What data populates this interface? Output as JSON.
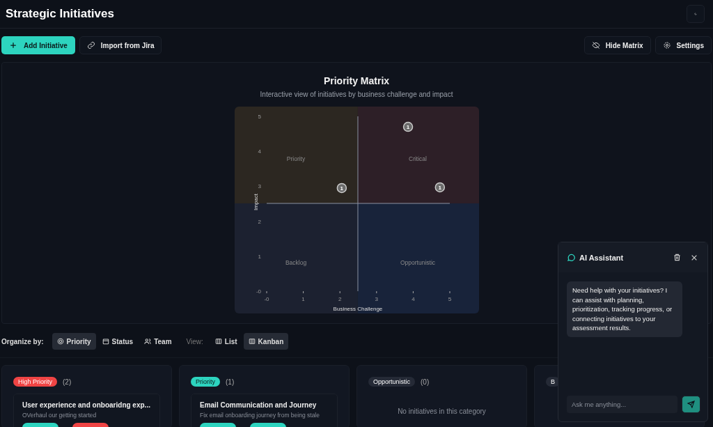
{
  "header": {
    "title": "Strategic Initiatives"
  },
  "toolbar": {
    "left": [
      {
        "label": "Add Initiative",
        "kind": "primary"
      },
      {
        "label": "Import from Jira",
        "kind": "link"
      }
    ],
    "right": [
      {
        "label": "Hide Matrix",
        "kind": "hide"
      },
      {
        "label": "Settings",
        "kind": "settings"
      }
    ]
  },
  "matrix": {
    "title": "Priority Matrix",
    "subtitle": "Interactive view of initiatives by business challenge and impact",
    "quadrants": [
      {
        "label": "Priority",
        "color": "#2c2721"
      },
      {
        "label": "Critical",
        "color": "#2d1f27"
      },
      {
        "label": "Backlog",
        "color": "#1c2130"
      },
      {
        "label": "Opportunistic",
        "color": "#18233a"
      }
    ],
    "chart_data": {
      "type": "scatter",
      "xlabel": "Business Challenge",
      "ylabel": "Impact",
      "xlim": [
        0,
        5
      ],
      "ylim": [
        0,
        5
      ],
      "xticks": [
        {
          "value": 0,
          "label": "-0"
        },
        1,
        2,
        3,
        4,
        5
      ],
      "yticks": [
        {
          "value": 0,
          "label": "-0"
        },
        1,
        2,
        3,
        4,
        5
      ],
      "x": [
        3.86,
        2.05,
        4.73
      ],
      "series": [
        {
          "color": "#6b6b6b",
          "values": [
            4.7,
            2.95,
            2.97
          ]
        }
      ],
      "value_labels": [
        "1",
        "1",
        "1"
      ],
      "ref_lines": [
        {
          "axis": "x",
          "value": 2.49
        },
        {
          "axis": "y",
          "value": 2.51
        }
      ]
    }
  },
  "organize": {
    "label": "Organize by:",
    "options": [
      {
        "label": "Priority",
        "selected": true
      },
      {
        "label": "Status",
        "selected": false
      },
      {
        "label": "Team",
        "selected": false
      }
    ],
    "view_label": "View:",
    "views": [
      {
        "label": "List",
        "selected": false
      },
      {
        "label": "Kanban",
        "selected": true
      }
    ]
  },
  "columns": [
    {
      "badge": "High Priority",
      "color": "#ef4444",
      "count": "(2)",
      "cards": [
        {
          "title": "User experience and onboaridng exp...",
          "description": "OVerhaul our getting started",
          "tags": [
            {
              "color": "#2dd4bf"
            },
            {
              "color": "#ef4444"
            }
          ]
        }
      ]
    },
    {
      "badge": "Priority",
      "color": "#2dd4bf",
      "count": "(1)",
      "cards": [
        {
          "title": "Email Communication and Journey",
          "description": "Fix email onboarding journey from being stale",
          "tags": [
            {
              "color": "#2dd4bf"
            },
            {
              "color": "#2dd4bf"
            }
          ]
        }
      ]
    },
    {
      "badge": "Opportunistic",
      "color": "#252a36",
      "count": "(0)",
      "empty": "No initiatives in this category"
    },
    {
      "badge": "B",
      "color": "#252a36"
    }
  ],
  "assistant": {
    "title": "AI Assistant",
    "message": "Need help with your initiatives? I can assist with planning, prioritization, tracking progress, or connecting initiatives to your assessment results.",
    "placeholder": "Ask me anything..."
  }
}
